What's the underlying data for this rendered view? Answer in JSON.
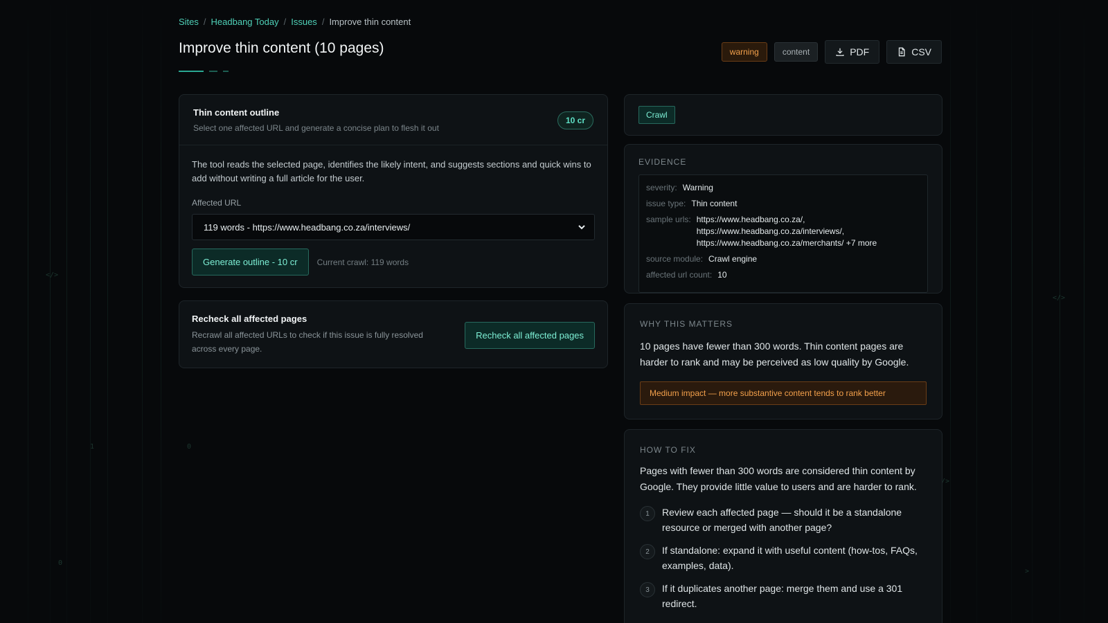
{
  "breadcrumb": {
    "sites": "Sites",
    "site": "Headbang Today",
    "issues": "Issues",
    "current": "Improve thin content"
  },
  "page": {
    "title": "Improve thin content (10 pages)"
  },
  "tags": {
    "severity": "warning",
    "category": "content"
  },
  "export": {
    "pdf": "PDF",
    "csv": "CSV"
  },
  "outline_card": {
    "title": "Thin content outline",
    "subtitle": "Select one affected URL and generate a concise plan to flesh it out",
    "credits": "10 cr",
    "description": "The tool reads the selected page, identifies the likely intent, and suggests sections and quick wins to add without writing a full article for the user.",
    "field_label": "Affected URL",
    "selected_url": "119 words - https://www.headbang.co.za/interviews/",
    "generate_button": "Generate outline - 10 cr",
    "current_crawl": "Current crawl: 119 words"
  },
  "recheck_card": {
    "title": "Recheck all affected pages",
    "description": "Recrawl all affected URLs to check if this issue is fully resolved across every page.",
    "button": "Recheck all affected pages"
  },
  "crawl_chip": "Crawl",
  "evidence": {
    "label": "EVIDENCE",
    "severity_key": "severity:",
    "severity_val": "Warning",
    "issue_type_key": "issue type:",
    "issue_type_val": "Thin content",
    "sample_urls_key": "sample urls:",
    "sample_urls": [
      "https://www.headbang.co.za/,",
      "https://www.headbang.co.za/interviews/,",
      "https://www.headbang.co.za/merchants/ +7 more"
    ],
    "source_module_key": "source module:",
    "source_module_val": "Crawl engine",
    "affected_count_key": "affected url count:",
    "affected_count_val": "10"
  },
  "why": {
    "label": "WHY THIS MATTERS",
    "text": "10 pages have fewer than 300 words. Thin content pages are harder to rank and may be perceived as low quality by Google.",
    "impact": "Medium impact — more substantive content tends to rank better"
  },
  "fix": {
    "label": "HOW TO FIX",
    "text": "Pages with fewer than 300 words are considered thin content by Google. They provide little value to users and are harder to rank.",
    "steps": [
      {
        "n": "1",
        "text": "Review each affected page — should it be a standalone resource or merged with another page?"
      },
      {
        "n": "2",
        "text": "If standalone: expand it with useful content (how-tos, FAQs, examples, data)."
      },
      {
        "n": "3",
        "text": "If it duplicates another page: merge them and use a 301 redirect."
      }
    ]
  },
  "colors": {
    "accent": "#4fd1b8",
    "warning": "#f3a04b",
    "background": "#07090b"
  }
}
